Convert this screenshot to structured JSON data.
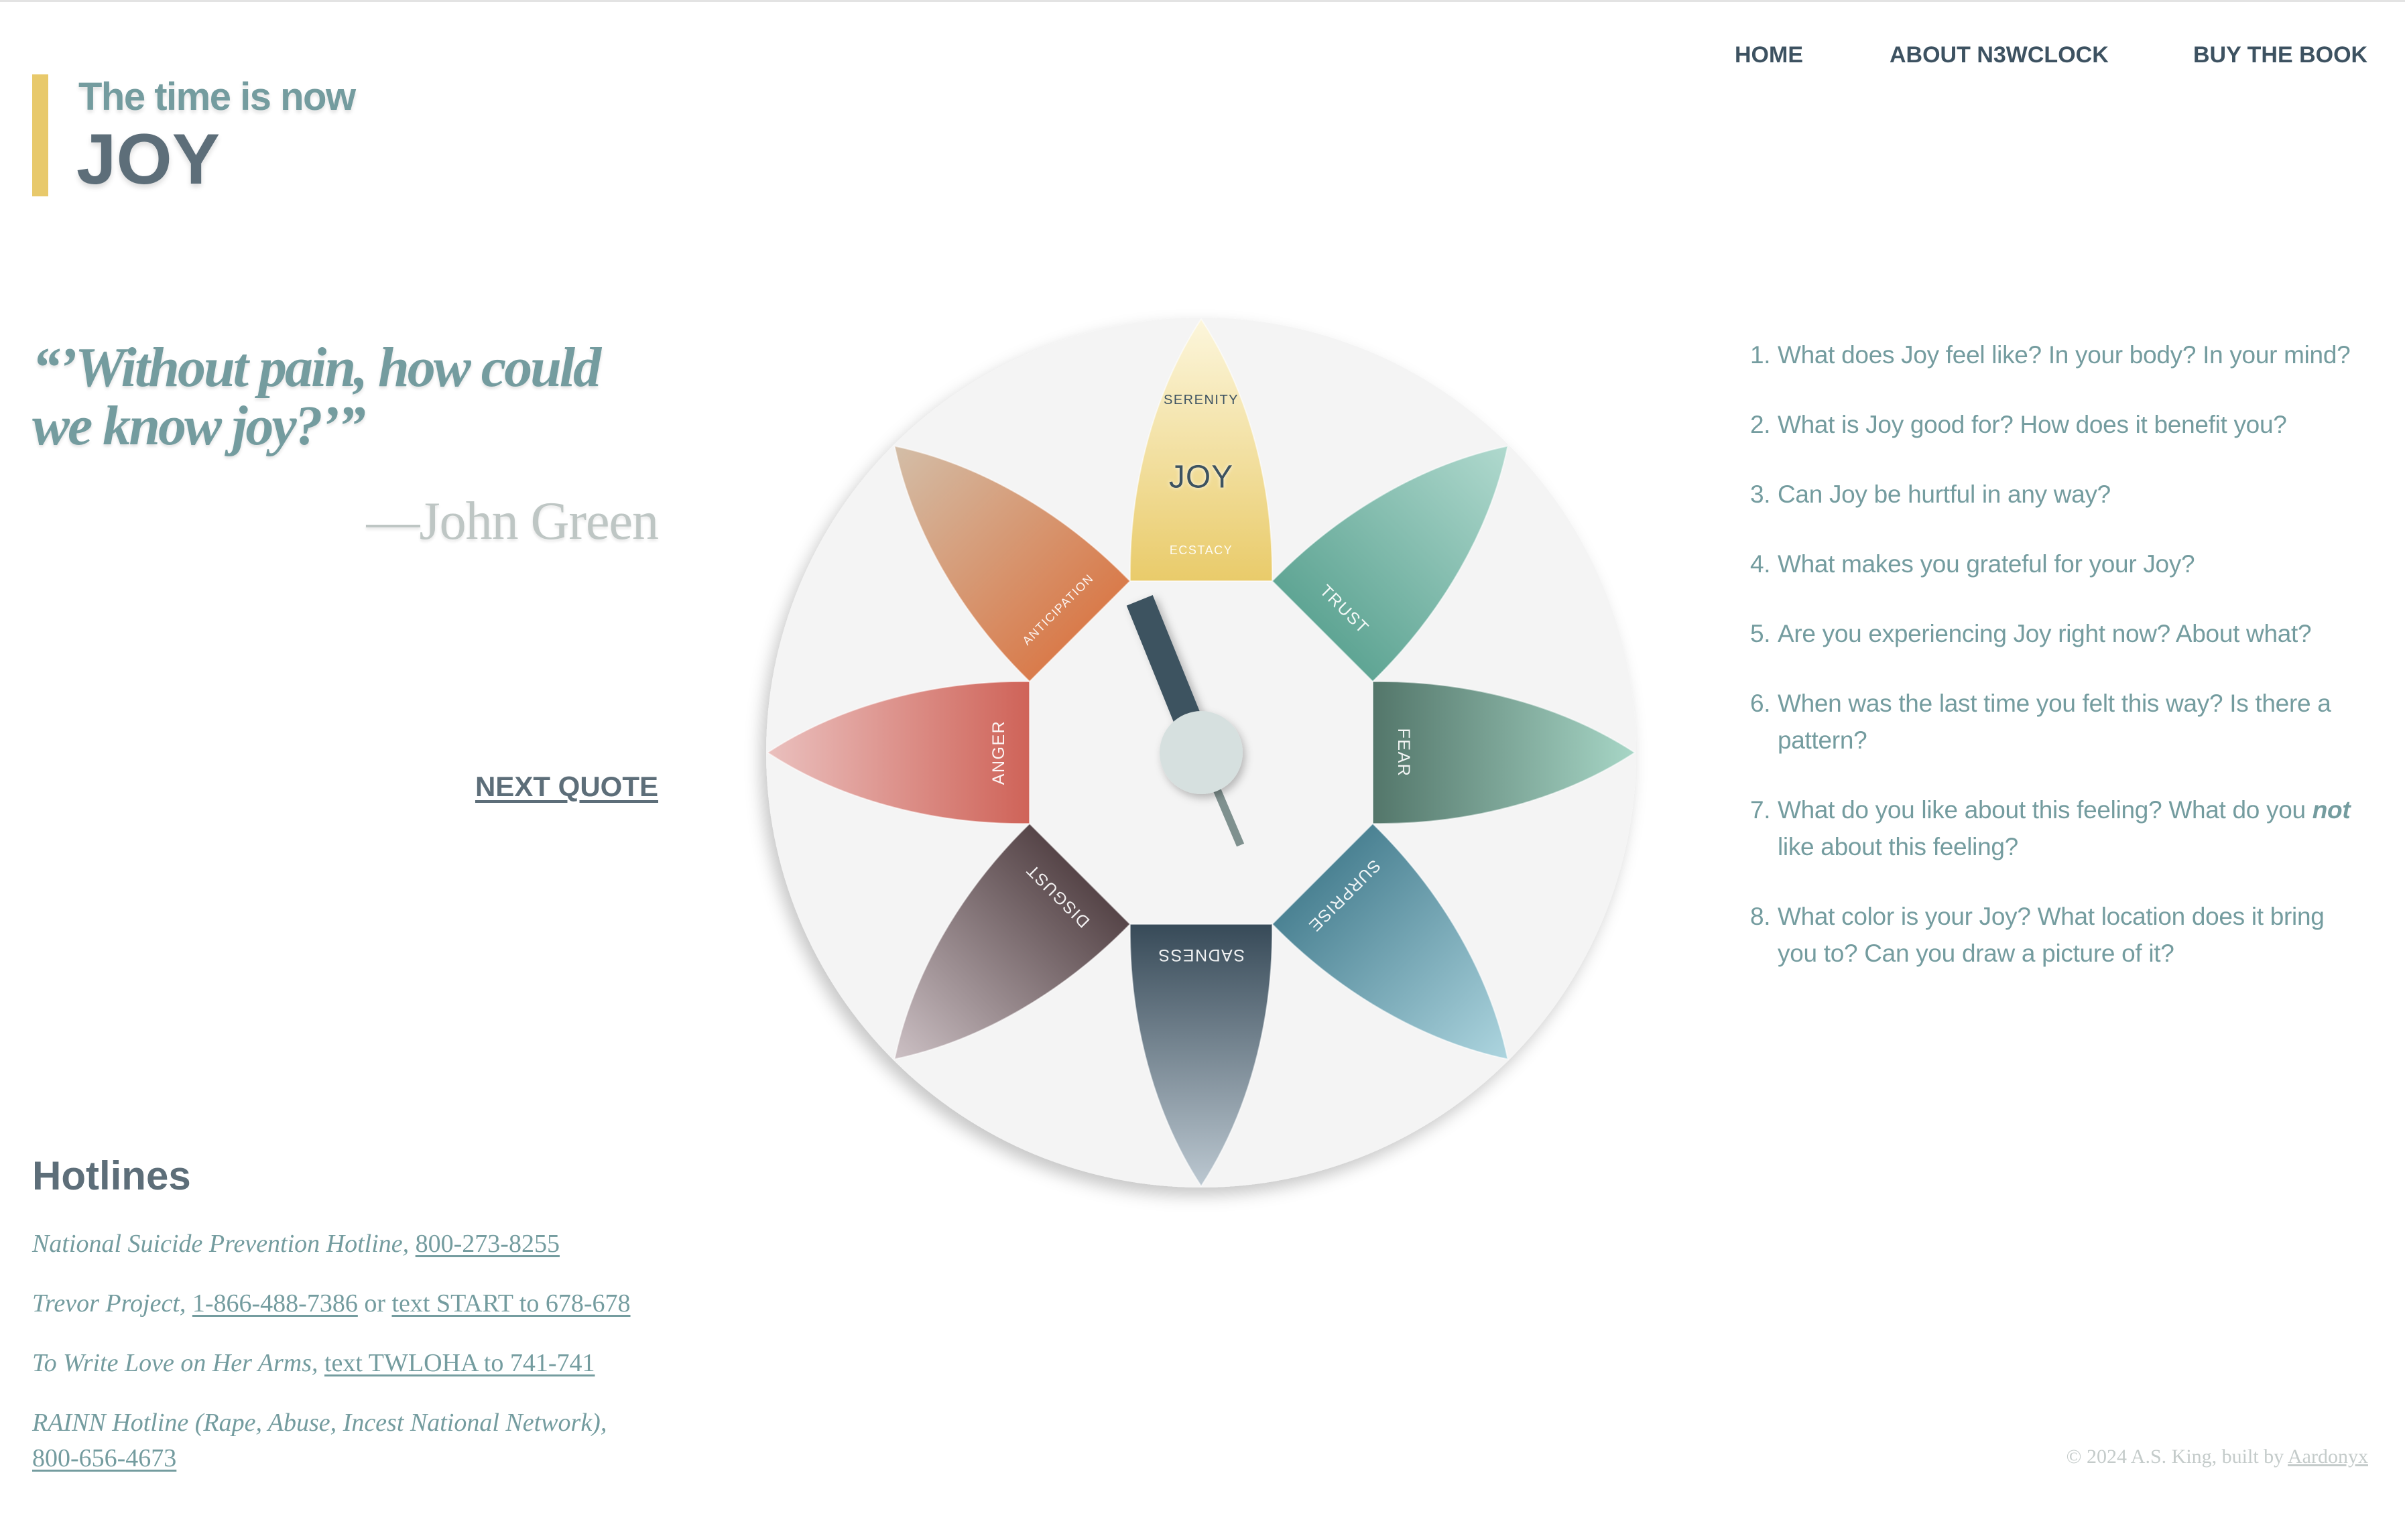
{
  "nav": {
    "home": "HOME",
    "about": "ABOUT N3WCLOCK",
    "buy": "BUY THE BOOK"
  },
  "header": {
    "kicker": "The time is now",
    "emotion": "JOY"
  },
  "quote": {
    "text": "“’Without pain, how could we know joy?’”",
    "author": "—John Green",
    "next_label": "NEXT QUOTE"
  },
  "hotlines": {
    "title": "Hotlines",
    "items": [
      {
        "label": "National Suicide Prevention Hotline, ",
        "links": [
          "800-273-8255"
        ]
      },
      {
        "label": "Trevor Project, ",
        "links": [
          "1-866-488-7386",
          "text START to 678-678"
        ],
        "joiner": " or "
      },
      {
        "label": "To Write Love on Her Arms, ",
        "links": [
          "text TWLOHA to 741-741"
        ]
      },
      {
        "label": "RAINN Hotline (Rape, Abuse, Incest National Network), ",
        "links": [
          "800-656-4673"
        ]
      }
    ]
  },
  "wheel": {
    "active_emotion": "JOY",
    "petals": [
      {
        "name": "Joy",
        "base_color": "#e9cb6a",
        "tip_color": "#fcf6dc",
        "labels": [
          {
            "text": "SERENITY",
            "slot": "outer",
            "tone": "dark"
          },
          {
            "text": "JOY",
            "slot": "middle",
            "tone": "dark"
          },
          {
            "text": "ECSTACY",
            "slot": "inner",
            "tone": "light"
          }
        ]
      },
      {
        "name": "Trust",
        "base_color": "#5fa594",
        "tip_color": "#b0d9ce",
        "labels": [
          {
            "text": "TRUST",
            "slot": "inner",
            "tone": "light"
          }
        ]
      },
      {
        "name": "Fear",
        "base_color": "#53766a",
        "tip_color": "#a7d6c6",
        "labels": [
          {
            "text": "FEAR",
            "slot": "inner",
            "tone": "light"
          }
        ]
      },
      {
        "name": "Surprise",
        "base_color": "#4b8293",
        "tip_color": "#add5df",
        "labels": [
          {
            "text": "SURPRISE",
            "slot": "inner",
            "tone": "light"
          }
        ]
      },
      {
        "name": "Sadness",
        "base_color": "#374a58",
        "tip_color": "#bcc8d1",
        "labels": [
          {
            "text": "SADNESS",
            "slot": "inner",
            "tone": "light"
          }
        ]
      },
      {
        "name": "Disgust",
        "base_color": "#564548",
        "tip_color": "#ccc0c4",
        "labels": [
          {
            "text": "DISGUST",
            "slot": "inner",
            "tone": "light"
          }
        ]
      },
      {
        "name": "Anger",
        "base_color": "#cf6358",
        "tip_color": "#eac0be",
        "labels": [
          {
            "text": "ANGER",
            "slot": "inner",
            "tone": "light"
          }
        ]
      },
      {
        "name": "Anticipation",
        "base_color": "#d97b4b",
        "tip_color": "#d3bea8",
        "labels": [
          {
            "text": "ANTICIPATION",
            "slot": "inner",
            "tone": "light"
          }
        ]
      }
    ],
    "clock": {
      "hour_hand_angle_deg": 338,
      "minute_hand_angle_deg": 157
    }
  },
  "questions": [
    {
      "number": "1.",
      "text": "What does Joy feel like? In your body? In your mind?"
    },
    {
      "number": "2.",
      "text": "What is Joy good for? How does it benefit you?"
    },
    {
      "number": "3.",
      "text": "Can Joy be hurtful in any way?"
    },
    {
      "number": "4.",
      "text": "What makes you grateful for your Joy?"
    },
    {
      "number": "5.",
      "text": "Are you experiencing Joy right now? About what?"
    },
    {
      "number": "6.",
      "text": "When was the last time you felt this way? Is there a pattern?"
    },
    {
      "number": "7.",
      "text_before": "What do you like about this feeling? What do you ",
      "emphasis": "not",
      "text_after": " like about this feeling?"
    },
    {
      "number": "8.",
      "text": "What color is your Joy? What location does it bring you to? Can you draw a picture of it?"
    }
  ],
  "footer": {
    "copyright": "© 2024 A.S. King, built by ",
    "builder_link": "Aardonyx"
  },
  "colors": {
    "accent_yellow": "#e8c96b",
    "teal_text": "#749c9f",
    "slate_text": "#5d6e79",
    "nav_text": "#3d5261",
    "muted_gray": "#bec6c4",
    "wheel_background": "#f4f4f4",
    "hour_hand": "#3d5261",
    "minute_hand": "#7f918f",
    "hub": "#d6e0df"
  }
}
